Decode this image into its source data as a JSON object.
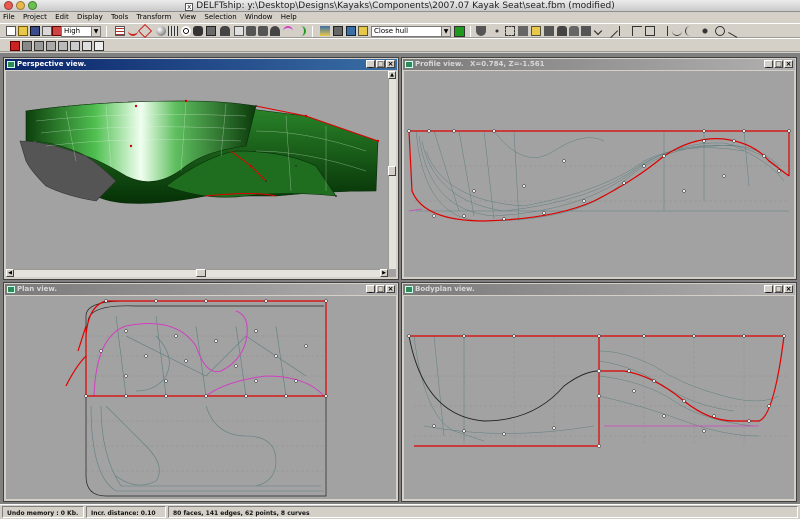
{
  "window": {
    "title": "DELFTship: y:\\Desktop\\Designs\\Kayaks\\Components\\2007.07 Kayak Seat\\seat.fbm (modified)"
  },
  "menu": [
    "File",
    "Project",
    "Edit",
    "Display",
    "Tools",
    "Transform",
    "View",
    "Selection",
    "Window",
    "Help"
  ],
  "toolbar": {
    "precision_value": "High",
    "layer_value": "Close hull",
    "layer_color": "#1e9a1e"
  },
  "views": {
    "perspective": {
      "title": "Perspective view."
    },
    "profile": {
      "title": "Profile view.",
      "coords": "X=0.784, Z=-1.561"
    },
    "plan": {
      "title": "Plan view."
    },
    "bodyplan": {
      "title": "Bodyplan view."
    }
  },
  "status": {
    "undo_memory": "Undo memory : 0 Kb.",
    "incr_distance": "Incr. distance: 0.10",
    "model_stats": "80 faces, 141 edges, 62 points, 8 curves"
  },
  "colors": {
    "active_title": "#0a246a",
    "hull_green": "#1e7a1e",
    "control_red": "#e00000",
    "curve_magenta": "#d040c0",
    "grid_line": "#8a8a8a",
    "background_view": "#a2a2a2"
  }
}
